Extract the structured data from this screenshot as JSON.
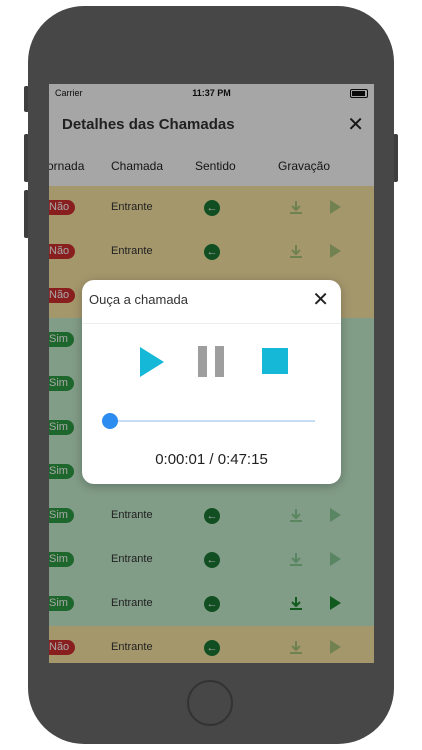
{
  "status_bar": {
    "carrier": "Carrier",
    "time": "11:37 PM"
  },
  "nav": {
    "title": "Detalhes das Chamadas",
    "close_icon": "close-icon"
  },
  "table": {
    "headers": [
      "ornada",
      "Chamada",
      "Sentido",
      "Gravação"
    ],
    "rows": [
      {
        "status": "Não",
        "chamada": "Entrante",
        "color": "red"
      },
      {
        "status": "Não",
        "chamada": "Entrante",
        "color": "red"
      },
      {
        "status": "Não",
        "chamada": "",
        "color": "red"
      },
      {
        "status": "Sim",
        "chamada": "",
        "color": "green"
      },
      {
        "status": "Sim",
        "chamada": "",
        "color": "green"
      },
      {
        "status": "Sim",
        "chamada": "",
        "color": "green"
      },
      {
        "status": "Sim",
        "chamada": "",
        "color": "green"
      },
      {
        "status": "Sim",
        "chamada": "Entrante",
        "color": "green"
      },
      {
        "status": "Sim",
        "chamada": "Entrante",
        "color": "green"
      },
      {
        "status": "Sim",
        "chamada": "Entrante",
        "color": "green"
      },
      {
        "status": "Não",
        "chamada": "Entrante",
        "color": "red"
      }
    ]
  },
  "modal": {
    "title": "Ouça a chamada",
    "close_icon": "close-icon",
    "time_display": "0:00:01 / 0:47:15",
    "progress_fraction": 0.0,
    "colors": {
      "accent": "#15b8d6",
      "slider": "#2d8cf0",
      "pause": "#9e9e9e"
    }
  }
}
